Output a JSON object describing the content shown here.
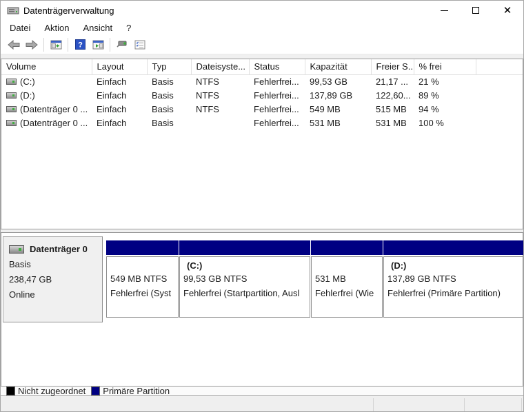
{
  "window": {
    "title": "Datenträgerverwaltung",
    "controls": {
      "minimize": "minimize",
      "maximize": "maximize",
      "close": "close"
    }
  },
  "menu": {
    "items": [
      {
        "label": "Datei"
      },
      {
        "label": "Aktion"
      },
      {
        "label": "Ansicht"
      },
      {
        "label": "?"
      }
    ]
  },
  "toolbar": {
    "icons": [
      {
        "name": "back-arrow-icon"
      },
      {
        "name": "forward-arrow-icon"
      },
      {
        "name": "console-tree-icon"
      },
      {
        "name": "help-icon"
      },
      {
        "name": "show-action-pane-icon"
      },
      {
        "name": "popup-menu-icon"
      },
      {
        "name": "properties-list-icon"
      }
    ]
  },
  "volume_list": {
    "headers": [
      "Volume",
      "Layout",
      "Typ",
      "Dateisyste...",
      "Status",
      "Kapazität",
      "Freier S...",
      "% frei"
    ],
    "rows": [
      {
        "cells": [
          "(C:)",
          "Einfach",
          "Basis",
          "NTFS",
          "Fehlerfrei...",
          "99,53 GB",
          "21,17 ...",
          "21 %"
        ]
      },
      {
        "cells": [
          "(D:)",
          "Einfach",
          "Basis",
          "NTFS",
          "Fehlerfrei...",
          "137,89 GB",
          "122,60...",
          "89 %"
        ]
      },
      {
        "cells": [
          "(Datenträger 0 ...",
          "Einfach",
          "Basis",
          "NTFS",
          "Fehlerfrei...",
          "549 MB",
          "515 MB",
          "94 %"
        ]
      },
      {
        "cells": [
          "(Datenträger 0 ...",
          "Einfach",
          "Basis",
          "",
          "Fehlerfrei...",
          "531 MB",
          "531 MB",
          "100 %"
        ]
      }
    ]
  },
  "disk": {
    "name": "Datenträger 0",
    "type": "Basis",
    "size": "238,47 GB",
    "status": "Online"
  },
  "partitions": [
    {
      "title": "",
      "size_line": "549 MB NTFS",
      "status_line": "Fehlerfrei (Syst"
    },
    {
      "title": "(C:)",
      "size_line": "99,53 GB NTFS",
      "status_line": "Fehlerfrei (Startpartition, Ausl"
    },
    {
      "title": "",
      "size_line": "531 MB",
      "status_line": "Fehlerfrei (Wie"
    },
    {
      "title": "(D:)",
      "size_line": "137,89 GB NTFS",
      "status_line": "Fehlerfrei (Primäre Partition)"
    }
  ],
  "legend": {
    "items": [
      {
        "label": "Nicht zugeordnet",
        "color": "#000000"
      },
      {
        "label": "Primäre Partition",
        "color": "#000082"
      }
    ]
  },
  "colors": {
    "primary_partition_band": "#000082",
    "unallocated": "#000000",
    "status_bar": "#efefef"
  }
}
